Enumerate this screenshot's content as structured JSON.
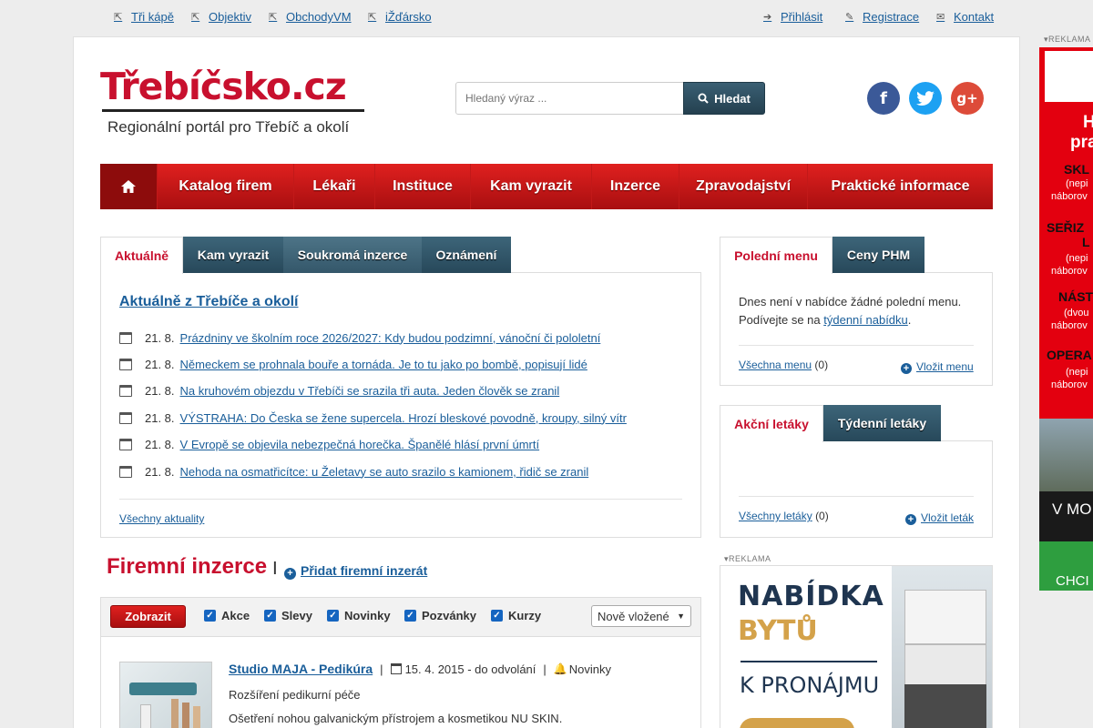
{
  "topbar": {
    "left_links": [
      "Tři kápě",
      "Objektiv",
      "ObchodyVM",
      "iŽďársko"
    ],
    "login": "Přihlásit",
    "register": "Registrace",
    "contact": "Kontakt"
  },
  "logo": {
    "title_main": "Třebíčsko",
    "title_tld": ".cz",
    "subtitle": "Regionální portál pro Třebíč a okolí"
  },
  "search": {
    "placeholder": "Hledaný výraz ...",
    "button": "Hledat"
  },
  "social": [
    "f",
    "t",
    "g+"
  ],
  "colors": {
    "brand_red": "#c8102e",
    "link": "#1a5e9a",
    "dark_tab": "#2f5265"
  },
  "nav": [
    "Katalog firem",
    "Lékaři",
    "Instituce",
    "Kam vyrazit",
    "Inzerce",
    "Zpravodajství",
    "Praktické informace"
  ],
  "news": {
    "tabs": [
      "Aktuálně",
      "Kam vyrazit",
      "Soukromá inzerce",
      "Oznámení"
    ],
    "heading": "Aktuálně z Třebíče a okolí",
    "items": [
      {
        "date": "21. 8.",
        "title": "Prázdniny ve školním roce 2026/2027: Kdy budou podzimní, vánoční či pololetní"
      },
      {
        "date": "21. 8.",
        "title": "Německem se prohnala bouře a tornáda. Je to tu jako po bombě, popisují lidé"
      },
      {
        "date": "21. 8.",
        "title": "Na kruhovém objezdu v Třebíči se srazila tři auta. Jeden člověk se zranil"
      },
      {
        "date": "21. 8.",
        "title": "VÝSTRAHA: Do Česka se žene supercela. Hrozí bleskové povodně, kroupy, silný vítr"
      },
      {
        "date": "21. 8.",
        "title": "V Evropě se objevila nebezpečná horečka. Španělé hlásí první úmrtí"
      },
      {
        "date": "21. 8.",
        "title": "Nehoda na osmatřicítce: u Želetavy se auto srazilo s kamionem, řidič se zranil"
      }
    ],
    "all_link": "Všechny aktuality"
  },
  "lunch": {
    "tabs": [
      "Polední menu",
      "Ceny PHM"
    ],
    "text_1": "Dnes není v nabídce žádné polední menu.",
    "text_2_prefix": "Podívejte se na",
    "text_2_link": "týdenní nabídku",
    "text_2_suffix": ".",
    "all_link": "Všechna menu",
    "count": "(0)",
    "add_link": "Vložit menu"
  },
  "leaflets": {
    "tabs": [
      "Akční letáky",
      "Týdenní letáky"
    ],
    "all_link": "Všechny letáky",
    "count": "(0)",
    "add_link": "Vložit leták"
  },
  "ads": {
    "label": "REKLAMA",
    "flat": {
      "line1": "NABÍDKA",
      "line2": "BYTŮ",
      "line3": "K PRONÁJMU"
    },
    "side": [
      "H",
      "pra",
      "SKL",
      "(nepi",
      "náborov",
      "SEŘIZ",
      "L",
      "(nepi",
      "náborov",
      "NÁST",
      "(dvou",
      "náborov",
      "OPERA",
      "(nepi",
      "náborov",
      "V MO",
      "CHCI"
    ]
  },
  "firm": {
    "title": "Firemní inzerce",
    "separator": "|",
    "add_link": "Přidat firemní inzerát",
    "show_button": "Zobrazit",
    "filters": [
      "Akce",
      "Slevy",
      "Novinky",
      "Pozvánky",
      "Kurzy"
    ],
    "sort": "Nově vložené",
    "listing": {
      "title": "Studio MAJA - Pedikúra",
      "date": "15. 4. 2015 - do odvolání",
      "category": "Novinky",
      "line1": "Rozšíření pedikurní péče",
      "line2": "Ošetření nohou galvanickým přístrojem a kosmetikou NU SKIN."
    }
  }
}
